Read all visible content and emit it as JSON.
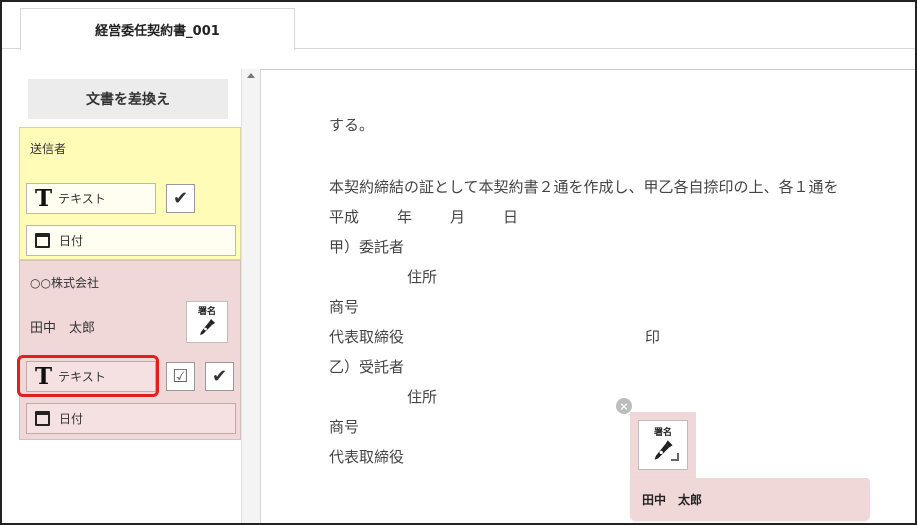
{
  "tab": {
    "title": "経営委任契約書_001"
  },
  "sidebar": {
    "swap_button": "文書を差換え",
    "sender": {
      "title": "送信者",
      "text_field": "テキスト",
      "date_field": "日付"
    },
    "receiver": {
      "company": "○○株式会社",
      "name": "田中　太郎",
      "signature_label": "署名",
      "text_field": "テキスト",
      "date_field": "日付"
    }
  },
  "document": {
    "lines": [
      "する。",
      "本契約締結の証として本契約書２通を作成し、甲乙各自捺印の上、各１通を",
      "平成",
      "年",
      "月",
      "日",
      "甲）委託者",
      "住所",
      "商号",
      "代表取締役",
      "印",
      "乙）受託者",
      "住所",
      "商号",
      "代表取締役"
    ]
  },
  "placed_signature": {
    "label": "署名",
    "signer": "田中　太郎",
    "remove_symbol": "×"
  },
  "colors": {
    "sender_bg": "#fffcb8",
    "receiver_bg": "#f0d8d8",
    "highlight": "#e0201f"
  }
}
